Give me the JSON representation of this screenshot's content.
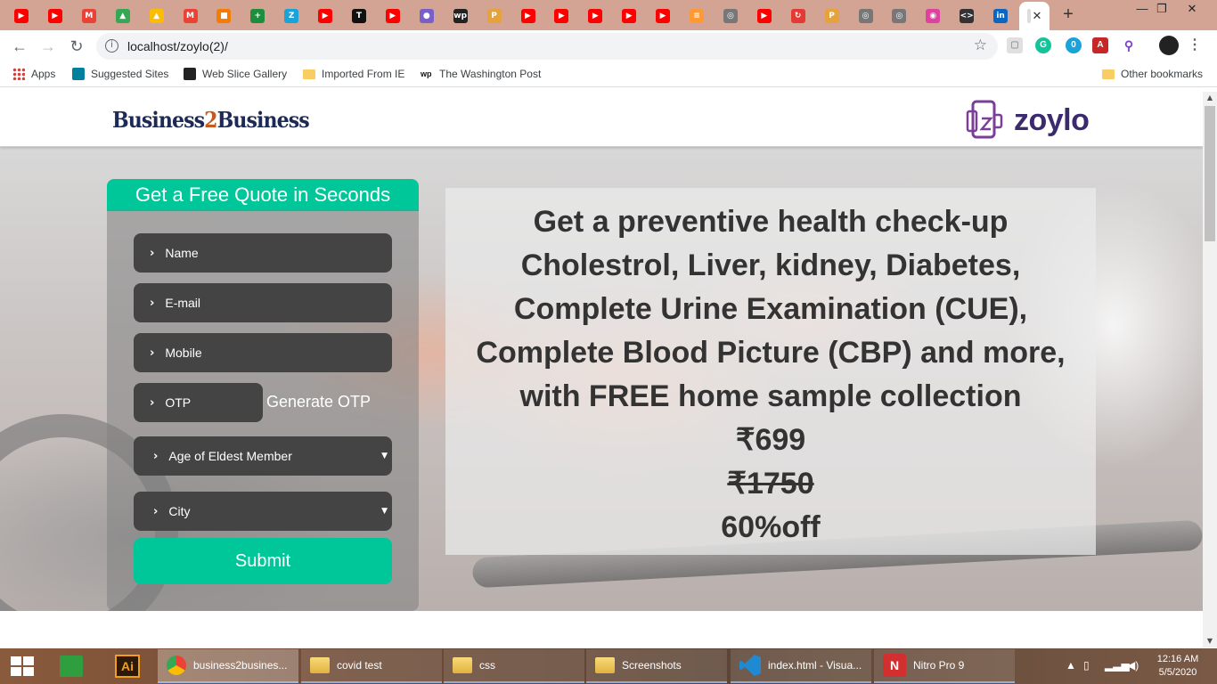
{
  "browser": {
    "tabs": [
      {
        "icon": "youtube-icon",
        "color": "#ff0000",
        "glyph": "▶"
      },
      {
        "icon": "youtube-icon",
        "color": "#ff0000",
        "glyph": "▶"
      },
      {
        "icon": "gmail-icon",
        "color": "#ea4335",
        "glyph": "M"
      },
      {
        "icon": "google-drive-icon",
        "color": "#34a853",
        "glyph": "▲"
      },
      {
        "icon": "google-drive-icon",
        "color": "#fbbc04",
        "glyph": "▲"
      },
      {
        "icon": "gmail-icon",
        "color": "#ea4335",
        "glyph": "M"
      },
      {
        "icon": "package-icon",
        "color": "#f57c00",
        "glyph": "■"
      },
      {
        "icon": "sheets-plus-icon",
        "color": "#1e8e3e",
        "glyph": "+"
      },
      {
        "icon": "zoho-icon",
        "color": "#1aa3d8",
        "glyph": "Z"
      },
      {
        "icon": "youtube-icon",
        "color": "#ff0000",
        "glyph": "▶"
      },
      {
        "icon": "nytimes-icon",
        "color": "#111111",
        "glyph": "T"
      },
      {
        "icon": "youtube-icon",
        "color": "#ff0000",
        "glyph": "▶"
      },
      {
        "icon": "circle-icon",
        "color": "#7b5fc9",
        "glyph": "●"
      },
      {
        "icon": "washington-post-icon",
        "color": "#222222",
        "glyph": "wp"
      },
      {
        "icon": "pma-icon",
        "color": "#e6a23c",
        "glyph": "P"
      },
      {
        "icon": "youtube-icon",
        "color": "#ff0000",
        "glyph": "▶"
      },
      {
        "icon": "youtube-icon",
        "color": "#ff0000",
        "glyph": "▶"
      },
      {
        "icon": "youtube-icon",
        "color": "#ff0000",
        "glyph": "▶"
      },
      {
        "icon": "youtube-icon",
        "color": "#ff0000",
        "glyph": "▶"
      },
      {
        "icon": "youtube-icon",
        "color": "#ff0000",
        "glyph": "▶"
      },
      {
        "icon": "india-flag-icon",
        "color": "#ff9933",
        "glyph": "≡"
      },
      {
        "icon": "globe-icon",
        "color": "#777777",
        "glyph": "◎"
      },
      {
        "icon": "youtube-icon",
        "color": "#ff0000",
        "glyph": "▶"
      },
      {
        "icon": "refresh-red-icon",
        "color": "#e53935",
        "glyph": "↻"
      },
      {
        "icon": "pma-icon",
        "color": "#e6a23c",
        "glyph": "P"
      },
      {
        "icon": "globe-icon",
        "color": "#777777",
        "glyph": "◎"
      },
      {
        "icon": "globe-icon",
        "color": "#777777",
        "glyph": "◎"
      },
      {
        "icon": "app-pink-icon",
        "color": "#e040a0",
        "glyph": "◉"
      },
      {
        "icon": "code-icon",
        "color": "#333333",
        "glyph": "<>"
      },
      {
        "icon": "linkedin-icon",
        "color": "#0a66c2",
        "glyph": "in"
      }
    ],
    "url": "localhost/zoylo(2)/",
    "bookmarks": [
      {
        "label": "Apps",
        "icon": "apps-grid-icon"
      },
      {
        "label": "Suggested Sites",
        "icon": "bing-icon"
      },
      {
        "label": "Web Slice Gallery",
        "icon": "web-slice-icon"
      },
      {
        "label": "Imported From IE",
        "icon": "folder-icon"
      },
      {
        "label": "The Washington Post",
        "icon": "washington-post-icon"
      },
      {
        "label": "Other bookmarks",
        "icon": "folder-icon"
      }
    ]
  },
  "page": {
    "brand_left": {
      "part1": "Business",
      "part2": "2",
      "part3": "Business"
    },
    "brand_right": "zoylo",
    "form": {
      "title": "Get a Free Quote in Seconds",
      "name": "Name",
      "email": "E-mail",
      "mobile": "Mobile",
      "otp": "OTP",
      "generate_otp": "Generate OTP",
      "age": "Age of Eldest Member",
      "city": "City",
      "submit": "Submit"
    },
    "offer": {
      "line1": "Get a preventive health check-up",
      "line2": "Cholestrol, Liver, kidney, Diabetes,",
      "line3": "Complete Urine Examination (CUE),",
      "line4": "Complete Blood Picture (CBP) and more,",
      "line5": "with FREE home sample collection",
      "price": "₹699",
      "old_price": "₹1750",
      "discount": "60%off"
    },
    "colors": {
      "accent": "#00c799",
      "field_bg": "#444444",
      "brand_navy": "#1c2a55",
      "brand_orange": "#c8591b",
      "zoylo_purple": "#3b2a6e"
    }
  },
  "taskbar": {
    "items": [
      {
        "label": "business2busines...",
        "icon": "chrome-icon"
      },
      {
        "label": "covid test",
        "icon": "folder-icon"
      },
      {
        "label": "css",
        "icon": "folder-icon"
      },
      {
        "label": "Screenshots",
        "icon": "folder-icon"
      },
      {
        "label": "index.html - Visua...",
        "icon": "vscode-icon"
      },
      {
        "label": "Nitro Pro 9",
        "icon": "nitro-icon"
      }
    ],
    "time": "12:16 AM",
    "date": "5/5/2020"
  }
}
